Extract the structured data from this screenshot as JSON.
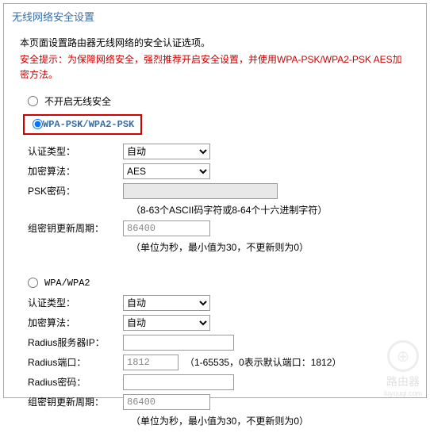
{
  "panel": {
    "title": "无线网络安全设置"
  },
  "intro": "本页面设置路由器无线网络的安全认证选项。",
  "warning": "安全提示：为保障网络安全，强烈推荐开启安全设置，并使用WPA-PSK/WPA2-PSK AES加密方法。",
  "options": {
    "disable_label": "不开启无线安全",
    "wpapsk_label": "WPA-PSK/WPA2-PSK",
    "wpa_label": "WPA/WPA2"
  },
  "wpapsk": {
    "auth_label": "认证类型：",
    "auth_value": "自动",
    "enc_label": "加密算法：",
    "enc_value": "AES",
    "psk_label": "PSK密码：",
    "psk_value": "",
    "psk_hint": "（8-63个ASCII码字符或8-64个十六进制字符）",
    "rekey_label": "组密钥更新周期：",
    "rekey_value": "86400",
    "rekey_hint": "（单位为秒，最小值为30，不更新则为0）"
  },
  "wpa": {
    "auth_label": "认证类型：",
    "auth_value": "自动",
    "enc_label": "加密算法：",
    "enc_value": "自动",
    "radius_ip_label": "Radius服务器IP：",
    "radius_ip_value": "",
    "radius_port_label": "Radius端口：",
    "radius_port_value": "1812",
    "radius_port_hint": "（1-65535，0表示默认端口：1812）",
    "radius_pw_label": "Radius密码：",
    "radius_pw_value": "",
    "rekey_label": "组密钥更新周期：",
    "rekey_value": "86400",
    "rekey_hint": "（单位为秒，最小值为30，不更新则为0）"
  },
  "watermark": {
    "text": "路由器",
    "url": "luyouqi.com"
  }
}
